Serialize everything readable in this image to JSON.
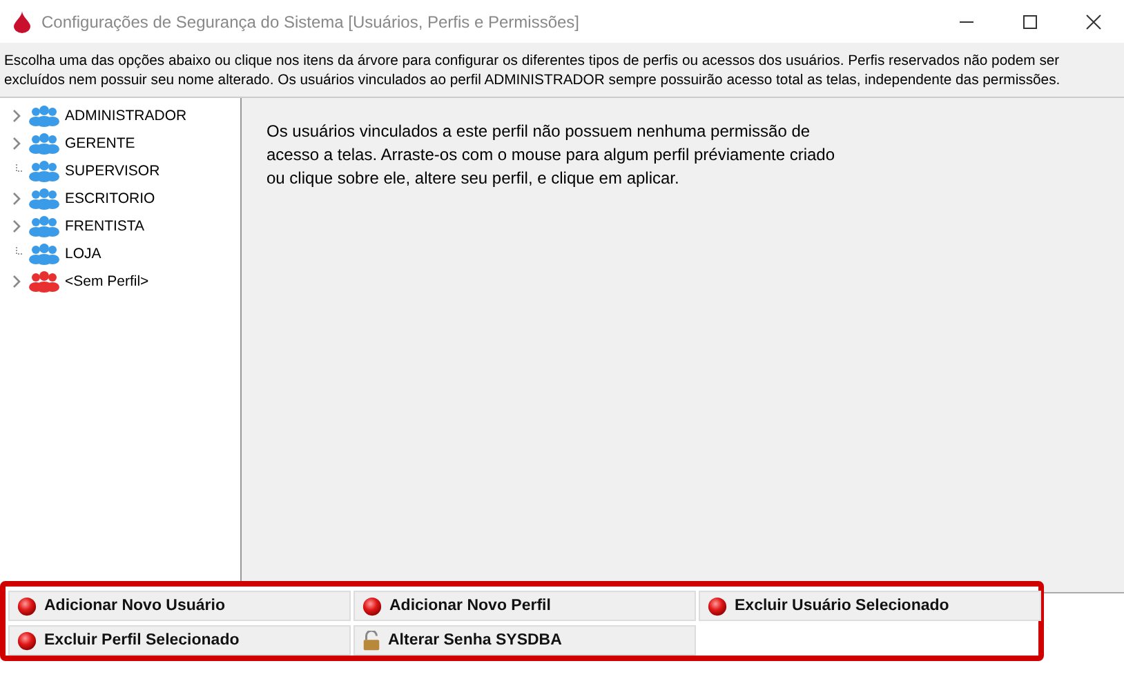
{
  "window": {
    "title": "Configurações de Segurança do Sistema [Usuários, Perfis e Permissões]"
  },
  "description": "Escolha uma das opções abaixo ou clique nos itens da árvore para configurar os diferentes tipos de perfis ou acessos dos usuários. Perfis reservados não podem ser excluídos nem possuir seu nome alterado. Os usuários vinculados ao perfil ADMINISTRADOR sempre possuirão acesso total as telas, independente das permissões.",
  "tree": [
    {
      "label": "ADMINISTRADOR",
      "expandable": true,
      "color": "#3a9be8"
    },
    {
      "label": "GERENTE",
      "expandable": true,
      "color": "#3a9be8"
    },
    {
      "label": "SUPERVISOR",
      "expandable": false,
      "color": "#3a9be8"
    },
    {
      "label": "ESCRITORIO",
      "expandable": true,
      "color": "#3a9be8"
    },
    {
      "label": "FRENTISTA",
      "expandable": true,
      "color": "#3a9be8"
    },
    {
      "label": "LOJA",
      "expandable": false,
      "color": "#3a9be8"
    },
    {
      "label": "<Sem Perfil>",
      "expandable": true,
      "color": "#e83030"
    }
  ],
  "info": "Os usuários vinculados a este perfil não possuem nenhuma permissão de acesso a telas. Arraste-os com o mouse para algum perfil préviamente criado ou clique sobre ele, altere seu perfil, e clique em aplicar.",
  "buttons": [
    {
      "label": "Adicionar Novo Usuário",
      "kind": "action"
    },
    {
      "label": "Adicionar Novo Perfil",
      "kind": "action"
    },
    {
      "label": "Excluir Usuário Selecionado",
      "kind": "action"
    },
    {
      "label": "Excluir Perfil Selecionado",
      "kind": "action"
    },
    {
      "label": "Alterar Senha SYSDBA",
      "kind": "password"
    }
  ]
}
